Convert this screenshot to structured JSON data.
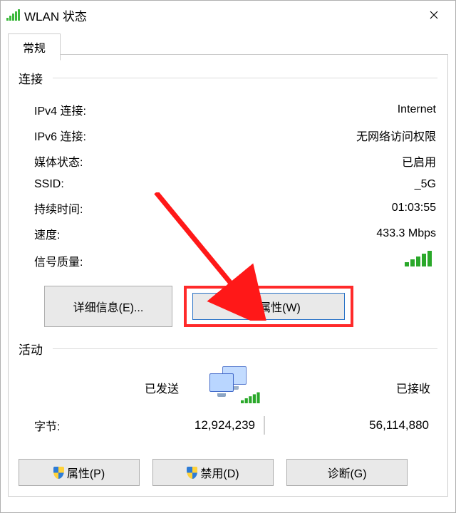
{
  "window": {
    "title": "WLAN 状态"
  },
  "tabs": {
    "general": "常规"
  },
  "sections": {
    "connection": {
      "heading": "连接",
      "ipv4_label": "IPv4 连接:",
      "ipv4_value": "Internet",
      "ipv6_label": "IPv6 连接:",
      "ipv6_value": "无网络访问权限",
      "media_label": "媒体状态:",
      "media_value": "已启用",
      "ssid_label": "SSID:",
      "ssid_value": "_5G",
      "duration_label": "持续时间:",
      "duration_value": "01:03:55",
      "speed_label": "速度:",
      "speed_value": "433.3 Mbps",
      "signal_label": "信号质量:",
      "details_btn": "详细信息(E)...",
      "wireless_props_btn": "无线属性(W)"
    },
    "activity": {
      "heading": "活动",
      "sent_label": "已发送",
      "recv_label": "已接收",
      "bytes_label": "字节:",
      "bytes_sent": "12,924,239",
      "bytes_recv": "56,114,880"
    }
  },
  "actions": {
    "properties": "属性(P)",
    "disable": "禁用(D)",
    "diagnose": "诊断(G)"
  }
}
